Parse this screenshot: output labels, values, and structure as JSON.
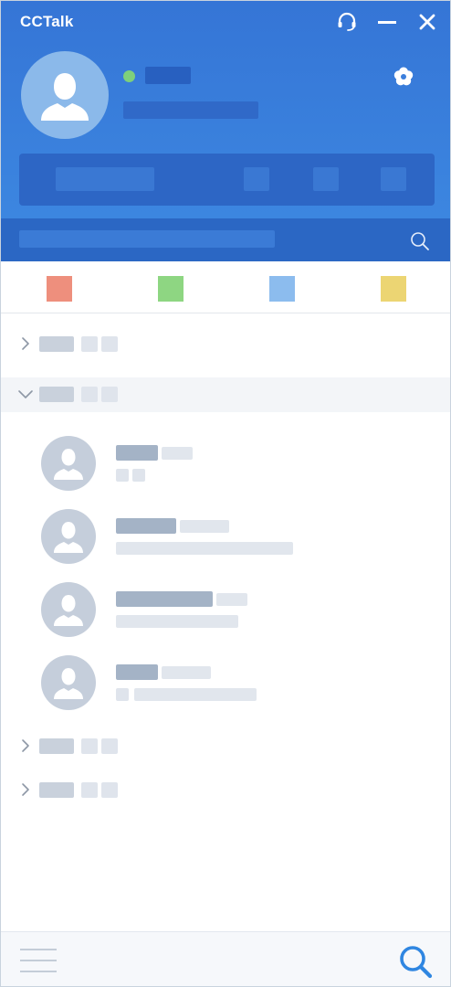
{
  "window": {
    "title": "CCTalk"
  },
  "colors": {
    "header_top": "#3575d6",
    "header_bottom": "#3c86e0",
    "search_bar": "#2b67c4",
    "status_online": "#7ed07b",
    "placeholder_dark": "#a4b3c6",
    "placeholder_light": "#dfe4ec",
    "group_selected_bg": "#f3f5f8",
    "accent_icon": "#2f86e1"
  },
  "icons": {
    "titlebar": [
      "headset-icon",
      "minimize-icon",
      "close-icon"
    ],
    "profile_setting": "flower-icon",
    "search": "search-icon",
    "menu": "menu-icon"
  },
  "search": {
    "placeholder": ""
  },
  "tabs": [
    {
      "name": "tab-1",
      "color": "#ee8f7d"
    },
    {
      "name": "tab-2",
      "color": "#8ed682"
    },
    {
      "name": "tab-3",
      "color": "#8cbcee"
    },
    {
      "name": "tab-4",
      "color": "#ecd573"
    }
  ],
  "groups": [
    {
      "expanded": false
    },
    {
      "expanded": true,
      "selected": true
    },
    {
      "expanded": false
    },
    {
      "expanded": false
    }
  ],
  "contacts_count_visible": 4
}
